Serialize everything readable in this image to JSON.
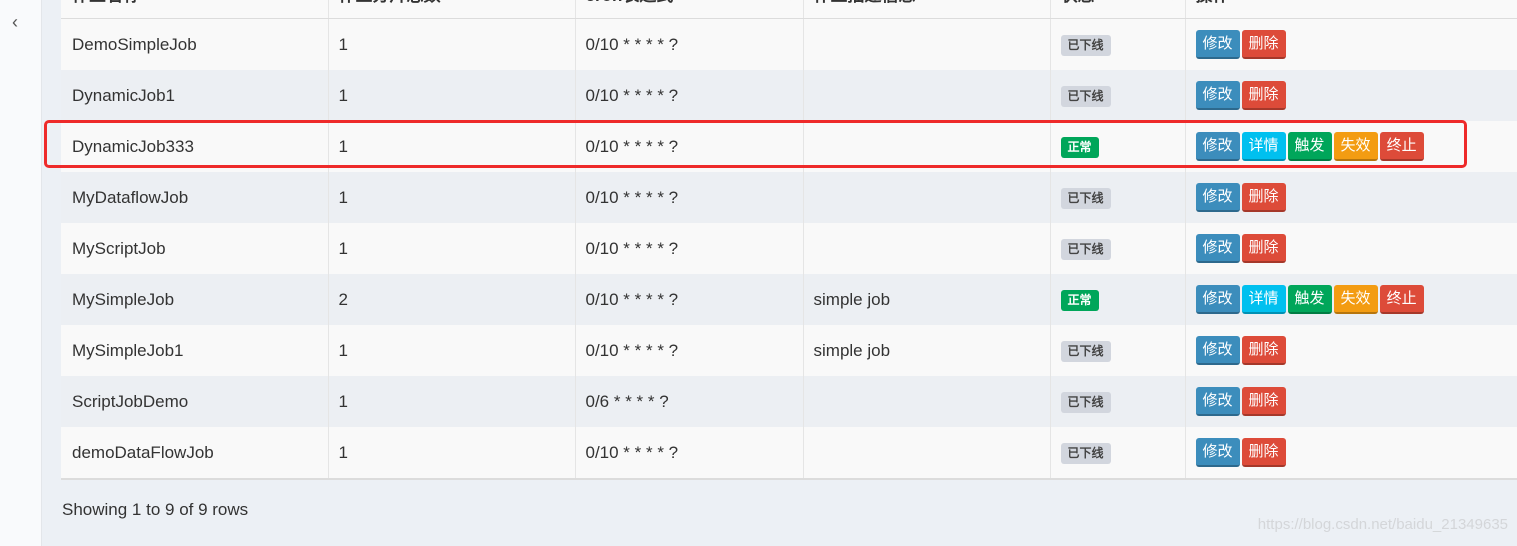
{
  "sidebar": {
    "collapse_icon": "chevron-left-icon",
    "collapse_glyph": "‹"
  },
  "table": {
    "columns": [
      {
        "label": "作业名称"
      },
      {
        "label": "作业分片总数"
      },
      {
        "label": "cron表达式"
      },
      {
        "label": "作业描述信息"
      },
      {
        "label": "状态"
      },
      {
        "label": "操作"
      }
    ],
    "rows": [
      {
        "name": "DemoSimpleJob",
        "shards": "1",
        "cron": "0/10 * * * * ?",
        "desc": "",
        "status": "已下线",
        "status_type": "offline",
        "actions": [
          "修改",
          "删除"
        ]
      },
      {
        "name": "DynamicJob1",
        "shards": "1",
        "cron": "0/10 * * * * ?",
        "desc": "",
        "status": "已下线",
        "status_type": "offline",
        "actions": [
          "修改",
          "删除"
        ]
      },
      {
        "name": "DynamicJob333",
        "shards": "1",
        "cron": "0/10 * * * * ?",
        "desc": "",
        "status": "正常",
        "status_type": "normal",
        "actions": [
          "修改",
          "详情",
          "触发",
          "失效",
          "终止"
        ]
      },
      {
        "name": "MyDataflowJob",
        "shards": "1",
        "cron": "0/10 * * * * ?",
        "desc": "",
        "status": "已下线",
        "status_type": "offline",
        "actions": [
          "修改",
          "删除"
        ]
      },
      {
        "name": "MyScriptJob",
        "shards": "1",
        "cron": "0/10 * * * * ?",
        "desc": "",
        "status": "已下线",
        "status_type": "offline",
        "actions": [
          "修改",
          "删除"
        ]
      },
      {
        "name": "MySimpleJob",
        "shards": "2",
        "cron": "0/10 * * * * ?",
        "desc": "simple job",
        "status": "正常",
        "status_type": "normal",
        "actions": [
          "修改",
          "详情",
          "触发",
          "失效",
          "终止"
        ]
      },
      {
        "name": "MySimpleJob1",
        "shards": "1",
        "cron": "0/10 * * * * ?",
        "desc": "simple job",
        "status": "已下线",
        "status_type": "offline",
        "actions": [
          "修改",
          "删除"
        ]
      },
      {
        "name": "ScriptJobDemo",
        "shards": "1",
        "cron": "0/6 * * * * ?",
        "desc": "",
        "status": "已下线",
        "status_type": "offline",
        "actions": [
          "修改",
          "删除"
        ]
      },
      {
        "name": "demoDataFlowJob",
        "shards": "1",
        "cron": "0/10 * * * * ?",
        "desc": "",
        "status": "已下线",
        "status_type": "offline",
        "actions": [
          "修改",
          "删除"
        ]
      }
    ]
  },
  "pagination": {
    "summary": "Showing 1 to 9 of 9 rows"
  },
  "watermark": "https://blog.csdn.net/baidu_21349635",
  "colors": {
    "edit": "#3c8dbc",
    "delete": "#dd4b39",
    "detail": "#00c0ef",
    "trigger": "#00a65a",
    "disable": "#f39c12",
    "shutdown": "#dd4b39",
    "highlight": "#ee2a2a"
  }
}
